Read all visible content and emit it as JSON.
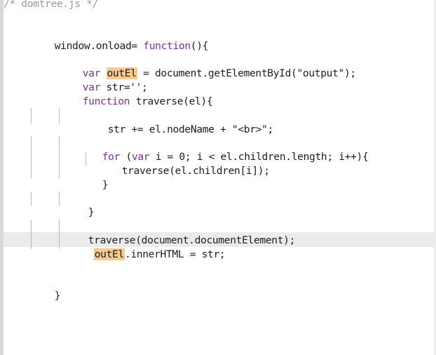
{
  "editor": {
    "lines": {
      "l01": "/* domtree.js */",
      "l02_a": "window.onload= ",
      "l02_b": "function",
      "l02_c": "(){",
      "l03_kw": "var ",
      "l03_hl": "outEl",
      "l03_rest": " = document.getElementById(\"output\");",
      "l04_kw": "var ",
      "l04_rest": "str='';",
      "l05_kw": "function ",
      "l05_rest": "traverse(el){",
      "l06": "str += el.nodeName + \"<br>\";",
      "l07_kw": "for ",
      "l07_a": "(",
      "l07_kw2": "var ",
      "l07_rest": "i = 0; i < el.children.length; i++){",
      "l08": "traverse(el.children[i]);",
      "l09": "}",
      "l10": "}",
      "l11": "traverse(document.documentElement);",
      "l12_hl": "outEl",
      "l12_rest": ".innerHTML = str;",
      "l13": "}"
    }
  },
  "colors": {
    "keyword": "#7b2ea1",
    "comment": "#9a9a9a",
    "highlight": "#f6c98f",
    "current_line": "#ebebeb"
  }
}
